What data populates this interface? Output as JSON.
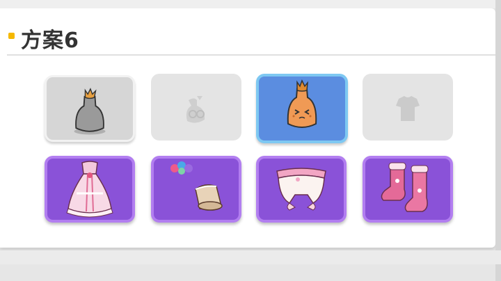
{
  "section": {
    "title": "方案6"
  },
  "slots": [
    {
      "icon": "gray-sack-icon"
    },
    {
      "icon": "empty-sack-placeholder-icon"
    },
    {
      "icon": "orange-sack-face-icon"
    },
    {
      "icon": "empty-shirt-placeholder-icon"
    },
    {
      "icon": "pink-dress-icon"
    },
    {
      "icon": "hairband-hat-icon"
    },
    {
      "icon": "frilled-bloomers-icon"
    },
    {
      "icon": "pink-boots-icon"
    }
  ],
  "colors": {
    "accent": "#f5b800",
    "selected": "#5b8de0",
    "rare": "#8a52d8"
  }
}
